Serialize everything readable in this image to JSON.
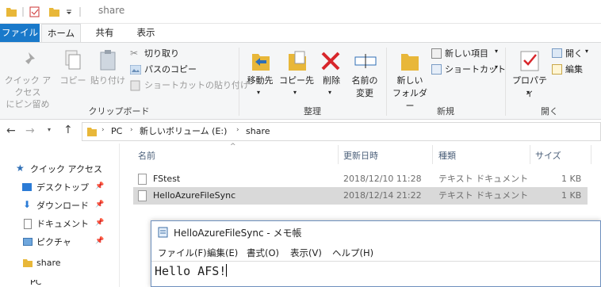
{
  "window": {
    "title": "share"
  },
  "tabs": [
    {
      "label": "ファイル"
    },
    {
      "label": "ホーム"
    },
    {
      "label": "共有"
    },
    {
      "label": "表示"
    }
  ],
  "ribbon": {
    "clipboard": {
      "group": "クリップボード",
      "pin": "クイック アクセス\nにピン留め",
      "copy": "コピー",
      "paste": "貼り付け",
      "cut": "切り取り",
      "copy_path": "パスのコピー",
      "paste_shortcut": "ショートカットの貼り付け"
    },
    "organize": {
      "group": "整理",
      "move_to": "移動先",
      "copy_to": "コピー先",
      "delete": "削除",
      "rename": "名前の\n変更"
    },
    "new": {
      "group": "新規",
      "new_folder": "新しい\nフォルダー",
      "new_item": "新しい項目",
      "shortcut": "ショートカット"
    },
    "open": {
      "group": "開く",
      "properties": "プロパティ",
      "open": "開く",
      "edit": "編集"
    }
  },
  "address": {
    "segments": [
      "PC",
      "新しいボリューム (E:)",
      "share"
    ]
  },
  "nav": {
    "quick_access": "クイック アクセス",
    "items": [
      {
        "label": "デスクトップ",
        "pinned": true
      },
      {
        "label": "ダウンロード",
        "pinned": true
      },
      {
        "label": "ドキュメント",
        "pinned": true
      },
      {
        "label": "ピクチャ",
        "pinned": true
      },
      {
        "label": "share",
        "pinned": false
      }
    ],
    "pc": "PC"
  },
  "files": {
    "headers": {
      "name": "名前",
      "date": "更新日時",
      "type": "種類",
      "size": "サイズ"
    },
    "rows": [
      {
        "name": "FStest",
        "date": "2018/12/10 11:28",
        "type": "テキスト ドキュメント",
        "size": "1 KB",
        "selected": false
      },
      {
        "name": "HelloAzureFileSync",
        "date": "2018/12/14 21:22",
        "type": "テキスト ドキュメント",
        "size": "1 KB",
        "selected": true
      }
    ]
  },
  "notepad": {
    "title": "HelloAzureFileSync - メモ帳",
    "menu": [
      "ファイル(F)",
      "編集(E)",
      "書式(O)",
      "表示(V)",
      "ヘルプ(H)"
    ],
    "content": "Hello AFS!"
  },
  "colors": {
    "accent": "#1979ca",
    "selected_row": "#d9d9d9",
    "folder": "#e8b739"
  }
}
